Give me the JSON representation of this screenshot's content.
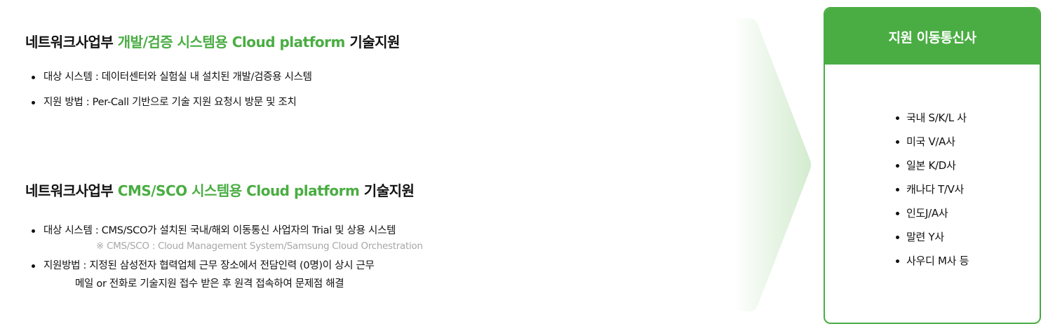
{
  "section1": {
    "title_prefix": "네트워크사업부 ",
    "title_accent": "개발/검증 시스템용 Cloud platform",
    "title_suffix": " 기술지원",
    "bullets": [
      "대상 시스템 : 데이터센터와 실험실 내 설치된 개발/검증용 시스템",
      "지원 방법 : Per-Call 기반으로 기술 지원 요청시 방문 및 조치"
    ]
  },
  "section2": {
    "title_prefix": "네트워크사업부 ",
    "title_accent": "CMS/SCO 시스템용 Cloud platform",
    "title_suffix": " 기술지원",
    "bullet1": "대상 시스템 : CMS/SCO가 설치된 국내/해외 이동통신 사업자의 Trial 및 상용 시스템",
    "bullet1_note": "※ CMS/SCO : Cloud Management System/Samsung Cloud Orchestration",
    "bullet2": "지원방법 : 지정된 삼성전자 협력업체 근무 장소에서 전담인력 (0명)이 상시 근무",
    "bullet2_cont": "메일 or 전화로 기술지원 접수 받은 후 원격 접속하여 문제점 해결"
  },
  "panel": {
    "title": "지원 이동통신사",
    "carriers": [
      "국내 S/K/L 사",
      "미국 V/A사",
      "일본 K/D사",
      "캐나다 T/V사",
      "인도J/A사",
      "말련 Y사",
      "사우디 M사 등"
    ]
  },
  "colors": {
    "accent": "#4aad43",
    "text": "#111111",
    "note": "#a7a7a7",
    "arrow_tint": "#d3ebcf"
  }
}
